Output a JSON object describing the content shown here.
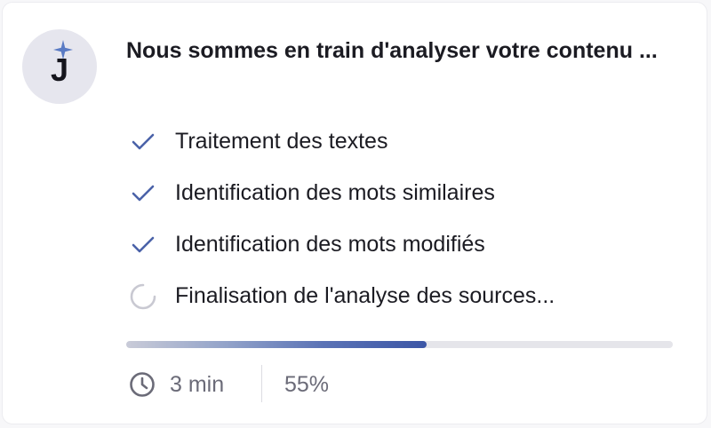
{
  "avatar": {
    "letter": "J",
    "icon": "sparkle-icon"
  },
  "title": "Nous sommes en train d'analyser votre contenu ...",
  "steps": [
    {
      "label": "Traitement des textes",
      "status": "done",
      "icon": "check-icon"
    },
    {
      "label": "Identification des mots similaires",
      "status": "done",
      "icon": "check-icon"
    },
    {
      "label": "Identification des mots modifiés",
      "status": "done",
      "icon": "check-icon"
    },
    {
      "label": "Finalisation de l'analyse des sources...",
      "status": "in-progress",
      "icon": "spinner-icon"
    }
  ],
  "progress": {
    "value": 0.55
  },
  "meta": {
    "time": "3 min",
    "time_icon": "clock-icon",
    "percent": "55%"
  },
  "colors": {
    "accent": "#3c56a6",
    "check": "#4a62a8",
    "text": "#1b1b22",
    "muted": "#6b6b78"
  }
}
